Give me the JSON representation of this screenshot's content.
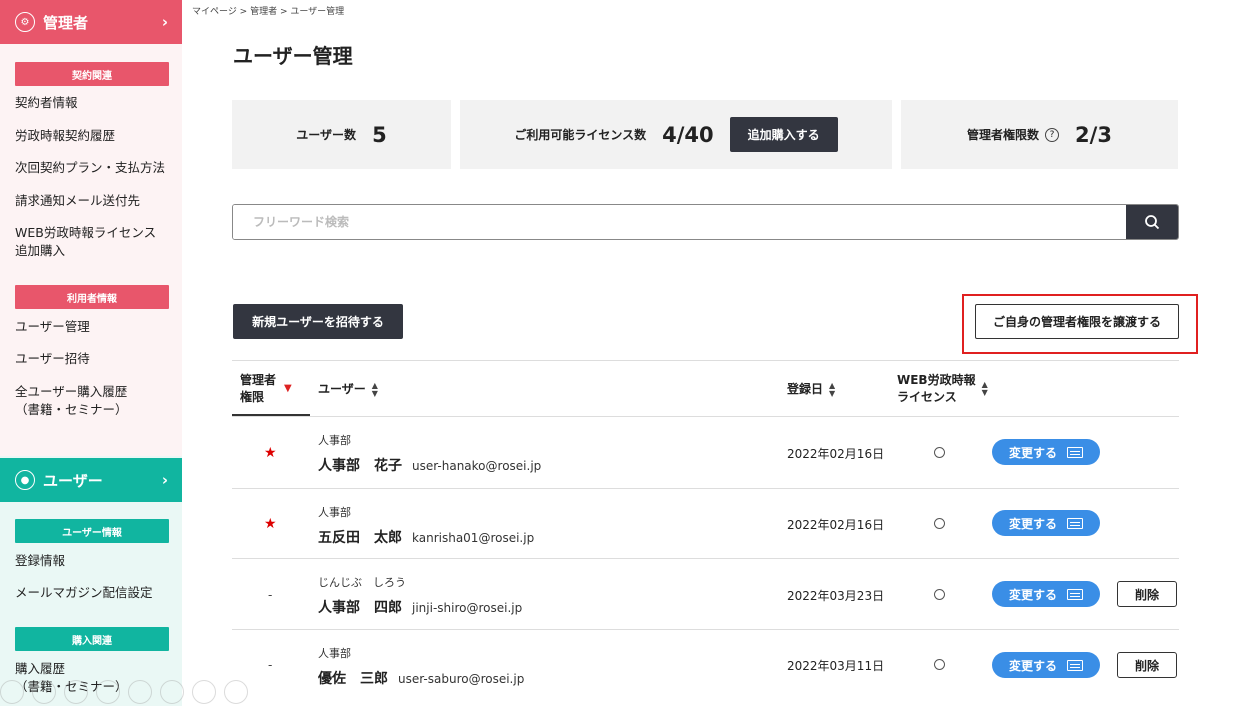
{
  "breadcrumb": "マイページ > 管理者 > ユーザー管理",
  "sidebar": {
    "admin": {
      "title": "管理者",
      "categories": {
        "contract": "契約関連",
        "users": "利用者情報"
      },
      "contract_links": [
        "契約者情報",
        "労政時報契約履歴",
        "次回契約プラン・支払方法",
        "請求通知メール送付先",
        "WEB労政時報ライセンス\n追加購入"
      ],
      "user_links": [
        "ユーザー管理",
        "ユーザー招待",
        "全ユーザー購入履歴\n（書籍・セミナー）"
      ]
    },
    "user": {
      "title": "ユーザー",
      "categories": {
        "info": "ユーザー情報",
        "purchase": "購入関連"
      },
      "info_links": [
        "登録情報",
        "メールマガジン配信設定"
      ],
      "purchase_links": [
        "購入履歴\n（書籍・セミナー）"
      ]
    }
  },
  "page_title": "ユーザー管理",
  "stats": {
    "user_count_label": "ユーザー数",
    "user_count_value": "5",
    "license_label": "ご利用可能ライセンス数",
    "license_value": "4/40",
    "buy_more_label": "追加購入する",
    "admin_label": "管理者権限数",
    "admin_value": "2/3"
  },
  "search": {
    "placeholder": "フリーワード検索"
  },
  "invite_button": "新規ユーザーを招待する",
  "transfer_button": "ご自身の管理者権限を譲渡する",
  "table": {
    "headers": {
      "admin": "管理者\n権限",
      "user": "ユーザー",
      "registered": "登録日",
      "license": "WEB労政時報\nライセンス"
    },
    "change_label": "変更する",
    "delete_label": "削除",
    "rows": [
      {
        "admin": "★",
        "dept": "人事部",
        "name": "人事部　花子",
        "email": "user-hanako@rosei.jp",
        "date": "2022年02月16日",
        "license": "○",
        "deletable": false
      },
      {
        "admin": "★",
        "dept": "人事部",
        "name": "五反田　太郎",
        "email": "kanrisha01@rosei.jp",
        "date": "2022年02月16日",
        "license": "○",
        "deletable": false
      },
      {
        "admin": "-",
        "dept": "じんじぶ　しろう",
        "name": "人事部　四郎",
        "email": "jinji-shiro@rosei.jp",
        "date": "2022年03月23日",
        "license": "○",
        "deletable": true
      },
      {
        "admin": "-",
        "dept": "人事部",
        "name": "優佐　三郎",
        "email": "user-saburo@rosei.jp",
        "date": "2022年03月11日",
        "license": "○",
        "deletable": true
      }
    ]
  },
  "colors": {
    "admin_accent": "#e8566b",
    "user_accent": "#11b5a0",
    "primary_button": "#3a8ee6",
    "dark_button": "#333640",
    "highlight": "#e02020"
  }
}
